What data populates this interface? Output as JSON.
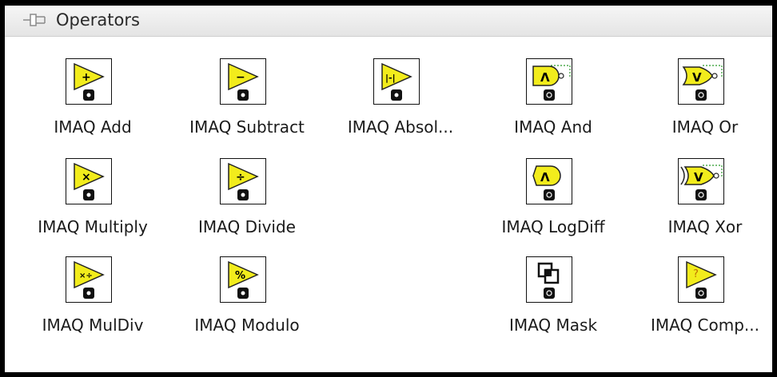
{
  "palette": {
    "title": "Operators",
    "items": [
      {
        "label": "IMAQ Add",
        "symbol": "+"
      },
      {
        "label": "IMAQ Subtract",
        "symbol": "−"
      },
      {
        "label": "IMAQ Absol...",
        "symbol": "|-|"
      },
      {
        "label": "IMAQ And",
        "symbol": "Λ"
      },
      {
        "label": "IMAQ Or",
        "symbol": "V"
      },
      {
        "label": "IMAQ Multiply",
        "symbol": "×"
      },
      {
        "label": "IMAQ Divide",
        "symbol": "÷"
      },
      {
        "label": "IMAQ LogDiff",
        "symbol": "Λ"
      },
      {
        "label": "IMAQ Xor",
        "symbol": "V"
      },
      {
        "label": "IMAQ MulDiv",
        "symbol": "×÷"
      },
      {
        "label": "IMAQ Modulo",
        "symbol": "%"
      },
      {
        "label": "IMAQ Mask",
        "symbol": "⧉"
      },
      {
        "label": "IMAQ Comp...",
        "symbol": "?"
      }
    ]
  },
  "colors": {
    "accent_yellow": "#f2ec1c",
    "frame": "#000000",
    "header_bg": "#eeeeee"
  }
}
